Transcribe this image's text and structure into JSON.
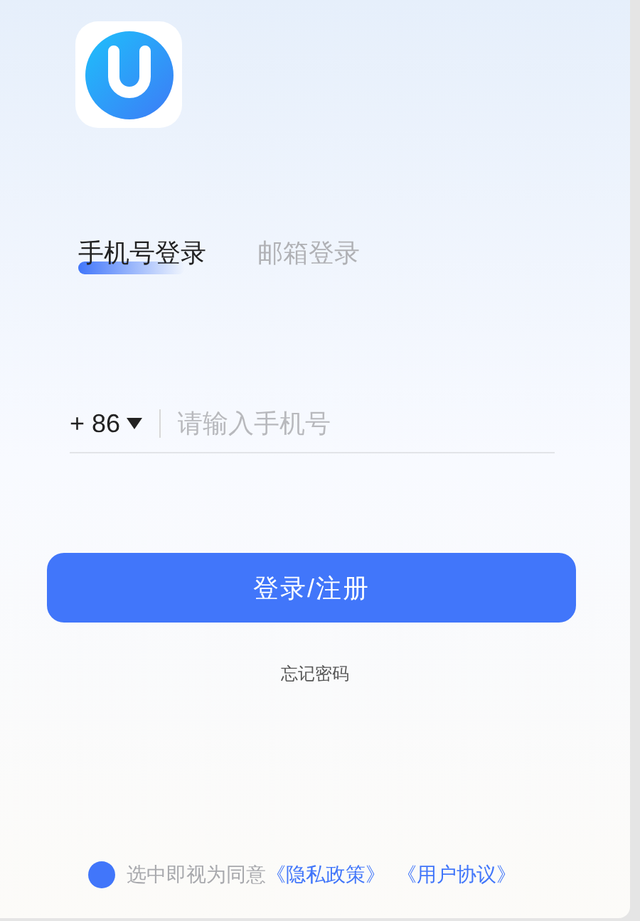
{
  "tabs": [
    {
      "label": "手机号登录",
      "selected": true
    },
    {
      "label": "邮箱登录",
      "selected": false
    }
  ],
  "phone": {
    "country_code": "+ 86",
    "placeholder": "请输入手机号"
  },
  "login_button": "登录/注册",
  "forgot_password": "忘记密码",
  "agreement": {
    "checked": true,
    "text": "选中即视为同意",
    "links": [
      "《隐私政策》",
      "《用户协议》"
    ]
  }
}
